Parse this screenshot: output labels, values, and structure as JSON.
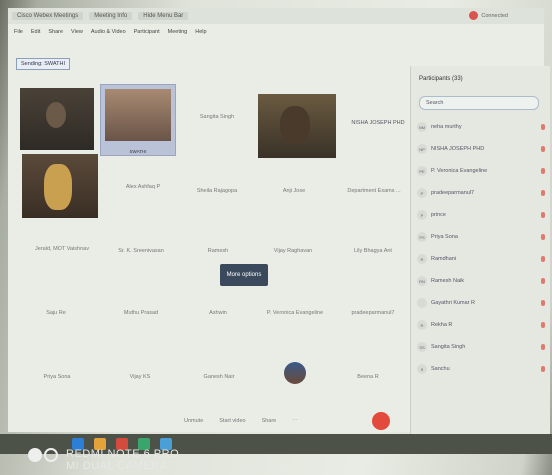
{
  "window": {
    "tabs": [
      "Cisco Webex Meetings",
      "Meeting Info",
      "Hide Menu Bar"
    ],
    "menu": [
      "File",
      "Edit",
      "Share",
      "View",
      "Audio & Video",
      "Participant",
      "Meeting",
      "Help"
    ],
    "connected_label": "Connected"
  },
  "sending_badge": "Sending: SWATHI",
  "tiles": {
    "video1": "",
    "video2": "SWATHI",
    "sangita": "Sangita Singh",
    "video3": "",
    "nisha": "NISHA JOSEPH PHD",
    "video4": "",
    "alex": "Alex Ashfaq P",
    "sheila": "Sheila Rajagopa",
    "anji": "Anji Jose",
    "dept": "Department Exams ...",
    "jerald": "Jerald, MOT Vaishnav",
    "sreenivas": "Sr. K. Sreenivasan",
    "ramesh": "Ramesh",
    "vijay": "Vijay Raghavan",
    "lily": "Lily Bhagya Ant",
    "saju": "Saju Re",
    "muthu": "Muthu Prasad",
    "ashwin": "Ashwin",
    "verinica": "P. Veronica Evangeline",
    "pradeep": "pradeeparmanul7",
    "priya": "Priya Sona",
    "vijuy": "Vijay KS",
    "ganesh": "Ganesh Nair",
    "beena": "Beena R"
  },
  "more_options": "More options",
  "controls": [
    "Unmute",
    "Start video",
    "Share",
    "⋯"
  ],
  "panel": {
    "title": "Participants (33)",
    "search_placeholder": "Search",
    "people": [
      {
        "ini": "NM",
        "name": "neha murthy"
      },
      {
        "ini": "NP",
        "name": "NISHA JOSEPH PHD"
      },
      {
        "ini": "PE",
        "name": "P. Veronica Evangeline"
      },
      {
        "ini": "P",
        "name": "pradeeparmanul7"
      },
      {
        "ini": "P",
        "name": "prince"
      },
      {
        "ini": "PS",
        "name": "Priya Sona"
      },
      {
        "ini": "R",
        "name": "Ramdhani"
      },
      {
        "ini": "RN",
        "name": "Ramesh Naik"
      },
      {
        "ini": "",
        "name": "Gayathri Kumar R"
      },
      {
        "ini": "R",
        "name": "Rekha R"
      },
      {
        "ini": "SS",
        "name": "Sangita Singh"
      },
      {
        "ini": "S",
        "name": "Sanchu"
      }
    ]
  },
  "watermark": {
    "line1": "REDMI NOTE 6 PRO",
    "line2": "MI DUAL CAMERA"
  },
  "colors": {
    "end_button": "#e24a3b",
    "more_options_bg": "#3a4a5c"
  }
}
